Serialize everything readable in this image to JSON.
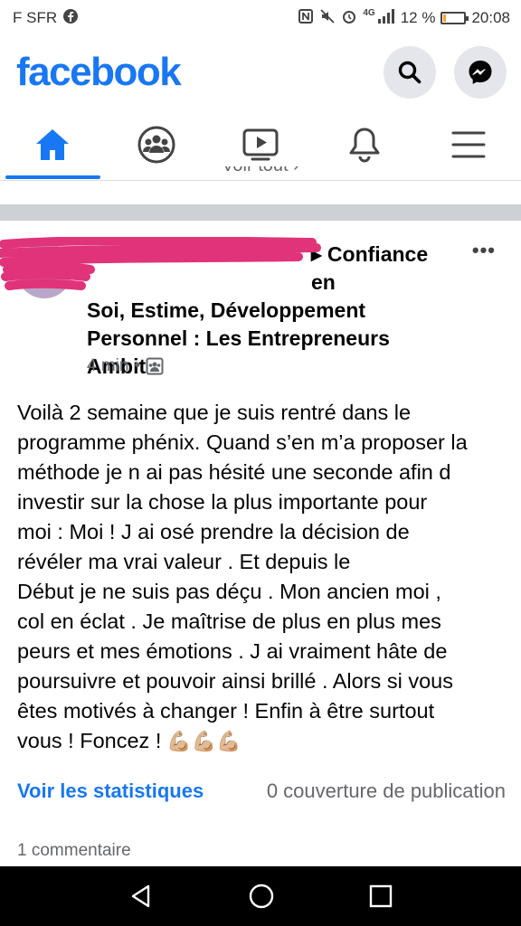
{
  "status_bar": {
    "carrier": "F SFR",
    "network": "4G",
    "battery_percent": "12 %",
    "battery_level": 0.12,
    "time": "20:08",
    "icons": [
      "facebook-icon",
      "nfc-icon",
      "mute-icon",
      "alarm-icon",
      "signal-icon",
      "battery-icon"
    ]
  },
  "header": {
    "logo": "facebook",
    "buttons": [
      "search-icon",
      "messenger-icon"
    ]
  },
  "nav": {
    "tabs": [
      {
        "name": "home",
        "icon": "home-icon",
        "active": true
      },
      {
        "name": "groups",
        "icon": "groups-icon",
        "active": false
      },
      {
        "name": "watch",
        "icon": "video-icon",
        "active": false
      },
      {
        "name": "notifications",
        "icon": "bell-icon",
        "active": false
      },
      {
        "name": "menu",
        "icon": "hamburger-icon",
        "active": false
      }
    ]
  },
  "feed": {
    "see_all": "Voir tout ›"
  },
  "post": {
    "title_lines": [
      "▸ Confiance en",
      "Soi, Estime, Développement",
      "Personnel : Les Entrepreneurs",
      "Ambit"
    ],
    "time": "4 min",
    "audience_icon": "group-audience-icon",
    "body_lines": [
      "Voilà 2 semaine que je suis rentré dans le",
      "programme phénix. Quand s’en m’a proposer la",
      "méthode je n ai pas hésité une seconde afin d",
      "investir sur la chose la plus importante pour",
      "moi : Moi ! J ai osé prendre la décision de",
      "révéler ma vrai valeur . Et depuis le",
      "Début je ne suis pas déçu . Mon ancien moi ,",
      "col en éclat . Je maîtrise de plus en plus mes",
      "peurs et mes émotions . J ai vraiment hâte de",
      "poursuivre et pouvoir ainsi brillé . Alors si vous",
      "êtes motivés à changer ! Enfin à être surtout",
      "vous ! Foncez !"
    ],
    "emojis": "💪🏼💪🏼💪🏼",
    "stats_link": "Voir les statistiques",
    "reach": "0 couverture de publication",
    "comments": "1 commentaire"
  },
  "colors": {
    "brand": "#1877f2",
    "redaction": "#e0337a"
  }
}
